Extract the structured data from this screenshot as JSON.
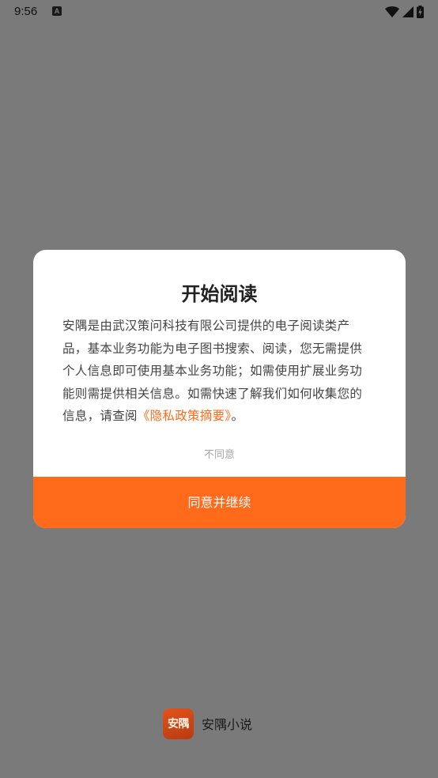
{
  "status_bar": {
    "time": "9:56",
    "notification_icon": "A"
  },
  "dialog": {
    "title": "开始阅读",
    "body_before_link": "安隅是由武汉策问科技有限公司提供的电子阅读类产品，基本业务功能为电子图书搜索、阅读，您无需提供个人信息即可使用基本业务功能；如需使用扩展业务功能则需提供相关信息。如需快速了解我们如何收集您的信息，请查阅",
    "policy_link": "《隐私政策摘要》",
    "body_after_link": "。",
    "decline_label": "不同意",
    "agree_label": "同意并继续"
  },
  "brand": {
    "logo_text": "安隅",
    "app_name": "安隅小说"
  },
  "colors": {
    "accent": "#ff6b1a",
    "overlay": "#7a7a7a"
  }
}
